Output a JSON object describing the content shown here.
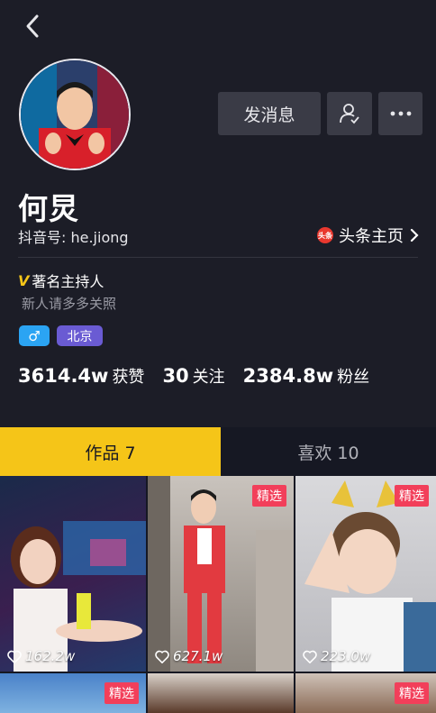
{
  "header": {
    "back_icon": "chevron-left-icon"
  },
  "profile": {
    "name": "何炅",
    "douyin_id": "抖音号: he.jiong",
    "toutiao_label": "头条主页",
    "toutiao_logo": "头条",
    "verify_mark": "V",
    "verify_text": "著名主持人",
    "bio": "新人请多多关照",
    "gender_tag": "♂",
    "city_tag": "北京"
  },
  "actions": {
    "message_label": "发消息",
    "follow_icon": "user-check-icon",
    "more_icon": "more-dots-icon"
  },
  "stats": {
    "likes_num": "3614.4w",
    "likes_label": "获赞",
    "following_num": "30",
    "following_label": "关注",
    "fans_num": "2384.8w",
    "fans_label": "粉丝"
  },
  "tabs": {
    "works": "作品 7",
    "likes": "喜欢 10"
  },
  "videos": [
    {
      "likes": "162.2w",
      "badge": ""
    },
    {
      "likes": "627.1w",
      "badge": "精选"
    },
    {
      "likes": "223.0w",
      "badge": "精选"
    },
    {
      "likes": "",
      "badge": "精选"
    },
    {
      "likes": "",
      "badge": ""
    },
    {
      "likes": "",
      "badge": "精选"
    }
  ],
  "colors": {
    "accent": "#f5c518",
    "badge": "#f23f5a",
    "gender": "#2ba4f3",
    "city": "#6a5bd3"
  }
}
